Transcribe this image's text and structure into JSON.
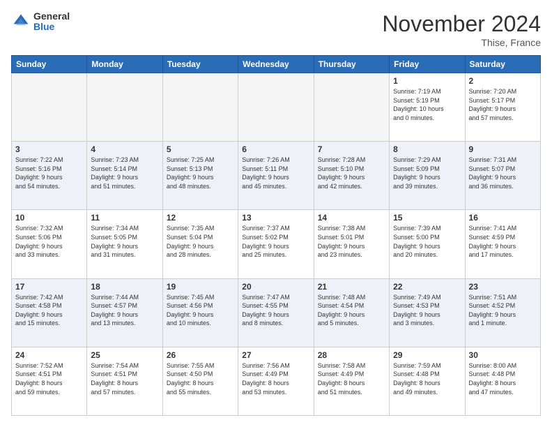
{
  "logo": {
    "general": "General",
    "blue": "Blue"
  },
  "header": {
    "month_year": "November 2024",
    "location": "Thise, France"
  },
  "weekdays": [
    "Sunday",
    "Monday",
    "Tuesday",
    "Wednesday",
    "Thursday",
    "Friday",
    "Saturday"
  ],
  "weeks": [
    [
      {
        "day": "",
        "info": ""
      },
      {
        "day": "",
        "info": ""
      },
      {
        "day": "",
        "info": ""
      },
      {
        "day": "",
        "info": ""
      },
      {
        "day": "",
        "info": ""
      },
      {
        "day": "1",
        "info": "Sunrise: 7:19 AM\nSunset: 5:19 PM\nDaylight: 10 hours\nand 0 minutes."
      },
      {
        "day": "2",
        "info": "Sunrise: 7:20 AM\nSunset: 5:17 PM\nDaylight: 9 hours\nand 57 minutes."
      }
    ],
    [
      {
        "day": "3",
        "info": "Sunrise: 7:22 AM\nSunset: 5:16 PM\nDaylight: 9 hours\nand 54 minutes."
      },
      {
        "day": "4",
        "info": "Sunrise: 7:23 AM\nSunset: 5:14 PM\nDaylight: 9 hours\nand 51 minutes."
      },
      {
        "day": "5",
        "info": "Sunrise: 7:25 AM\nSunset: 5:13 PM\nDaylight: 9 hours\nand 48 minutes."
      },
      {
        "day": "6",
        "info": "Sunrise: 7:26 AM\nSunset: 5:11 PM\nDaylight: 9 hours\nand 45 minutes."
      },
      {
        "day": "7",
        "info": "Sunrise: 7:28 AM\nSunset: 5:10 PM\nDaylight: 9 hours\nand 42 minutes."
      },
      {
        "day": "8",
        "info": "Sunrise: 7:29 AM\nSunset: 5:09 PM\nDaylight: 9 hours\nand 39 minutes."
      },
      {
        "day": "9",
        "info": "Sunrise: 7:31 AM\nSunset: 5:07 PM\nDaylight: 9 hours\nand 36 minutes."
      }
    ],
    [
      {
        "day": "10",
        "info": "Sunrise: 7:32 AM\nSunset: 5:06 PM\nDaylight: 9 hours\nand 33 minutes."
      },
      {
        "day": "11",
        "info": "Sunrise: 7:34 AM\nSunset: 5:05 PM\nDaylight: 9 hours\nand 31 minutes."
      },
      {
        "day": "12",
        "info": "Sunrise: 7:35 AM\nSunset: 5:04 PM\nDaylight: 9 hours\nand 28 minutes."
      },
      {
        "day": "13",
        "info": "Sunrise: 7:37 AM\nSunset: 5:02 PM\nDaylight: 9 hours\nand 25 minutes."
      },
      {
        "day": "14",
        "info": "Sunrise: 7:38 AM\nSunset: 5:01 PM\nDaylight: 9 hours\nand 23 minutes."
      },
      {
        "day": "15",
        "info": "Sunrise: 7:39 AM\nSunset: 5:00 PM\nDaylight: 9 hours\nand 20 minutes."
      },
      {
        "day": "16",
        "info": "Sunrise: 7:41 AM\nSunset: 4:59 PM\nDaylight: 9 hours\nand 17 minutes."
      }
    ],
    [
      {
        "day": "17",
        "info": "Sunrise: 7:42 AM\nSunset: 4:58 PM\nDaylight: 9 hours\nand 15 minutes."
      },
      {
        "day": "18",
        "info": "Sunrise: 7:44 AM\nSunset: 4:57 PM\nDaylight: 9 hours\nand 13 minutes."
      },
      {
        "day": "19",
        "info": "Sunrise: 7:45 AM\nSunset: 4:56 PM\nDaylight: 9 hours\nand 10 minutes."
      },
      {
        "day": "20",
        "info": "Sunrise: 7:47 AM\nSunset: 4:55 PM\nDaylight: 9 hours\nand 8 minutes."
      },
      {
        "day": "21",
        "info": "Sunrise: 7:48 AM\nSunset: 4:54 PM\nDaylight: 9 hours\nand 5 minutes."
      },
      {
        "day": "22",
        "info": "Sunrise: 7:49 AM\nSunset: 4:53 PM\nDaylight: 9 hours\nand 3 minutes."
      },
      {
        "day": "23",
        "info": "Sunrise: 7:51 AM\nSunset: 4:52 PM\nDaylight: 9 hours\nand 1 minute."
      }
    ],
    [
      {
        "day": "24",
        "info": "Sunrise: 7:52 AM\nSunset: 4:51 PM\nDaylight: 8 hours\nand 59 minutes."
      },
      {
        "day": "25",
        "info": "Sunrise: 7:54 AM\nSunset: 4:51 PM\nDaylight: 8 hours\nand 57 minutes."
      },
      {
        "day": "26",
        "info": "Sunrise: 7:55 AM\nSunset: 4:50 PM\nDaylight: 8 hours\nand 55 minutes."
      },
      {
        "day": "27",
        "info": "Sunrise: 7:56 AM\nSunset: 4:49 PM\nDaylight: 8 hours\nand 53 minutes."
      },
      {
        "day": "28",
        "info": "Sunrise: 7:58 AM\nSunset: 4:49 PM\nDaylight: 8 hours\nand 51 minutes."
      },
      {
        "day": "29",
        "info": "Sunrise: 7:59 AM\nSunset: 4:48 PM\nDaylight: 8 hours\nand 49 minutes."
      },
      {
        "day": "30",
        "info": "Sunrise: 8:00 AM\nSunset: 4:48 PM\nDaylight: 8 hours\nand 47 minutes."
      }
    ]
  ]
}
